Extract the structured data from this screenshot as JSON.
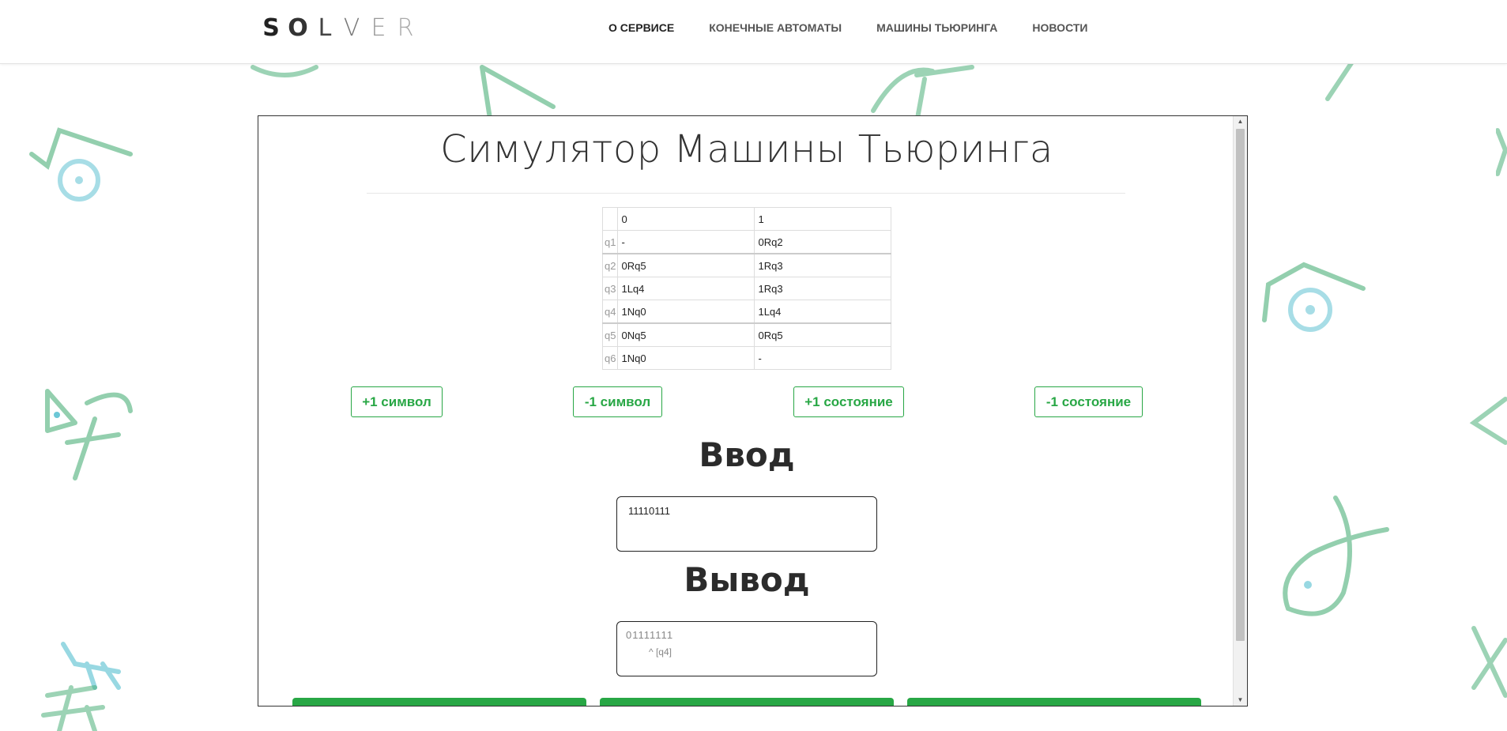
{
  "header": {
    "logo_letters": [
      "S",
      "O",
      "L",
      "V",
      "E",
      "R"
    ],
    "nav": [
      {
        "label": "О СЕРВИСЕ",
        "active": true
      },
      {
        "label": "КОНЕЧНЫЕ АВТОМАТЫ",
        "active": false
      },
      {
        "label": "МАШИНЫ ТЬЮРИНГА",
        "active": false
      },
      {
        "label": "НОВОСТИ",
        "active": false
      }
    ]
  },
  "main": {
    "title": "Симулятор Машины Тьюринга",
    "table": {
      "symbols": [
        "0",
        "1"
      ],
      "rows": [
        {
          "state": "q1",
          "cells": [
            "-",
            "0Rq2"
          ]
        },
        {
          "state": "q2",
          "cells": [
            "0Rq5",
            "1Rq3"
          ]
        },
        {
          "state": "q3",
          "cells": [
            "1Lq4",
            "1Rq3"
          ]
        },
        {
          "state": "q4",
          "cells": [
            "1Nq0",
            "1Lq4"
          ]
        },
        {
          "state": "q5",
          "cells": [
            "0Nq5",
            "0Rq5"
          ]
        },
        {
          "state": "q6",
          "cells": [
            "1Nq0",
            "-"
          ]
        }
      ]
    },
    "buttons": {
      "add_symbol": "+1 символ",
      "remove_symbol": "-1 символ",
      "add_state": "+1 состояние",
      "remove_state": "-1 состояние"
    },
    "input": {
      "heading": "Ввод",
      "value": "11110111"
    },
    "output": {
      "heading": "Вывод",
      "tape": "01111111",
      "head": "^ [q4]"
    }
  },
  "colors": {
    "accent": "#28a745",
    "doodle_green": "#3aa86b",
    "doodle_blue": "#6cc7d6"
  },
  "icons": [
    "scroll-up-arrow-icon",
    "scroll-down-arrow-icon"
  ]
}
